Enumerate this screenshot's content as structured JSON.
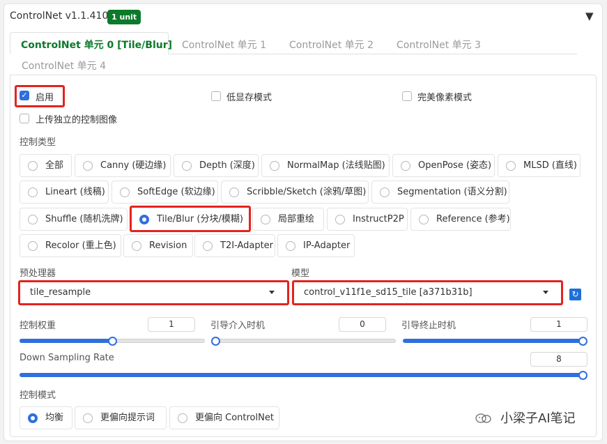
{
  "header": {
    "title": "ControlNet v1.1.410",
    "badge": "1 unit",
    "collapse_icon": "triangle-down-icon"
  },
  "tabs": [
    {
      "label": "ControlNet 单元 0 [Tile/Blur]",
      "active": true
    },
    {
      "label": "ControlNet 单元 1"
    },
    {
      "label": "ControlNet 单元 2"
    },
    {
      "label": "ControlNet 单元 3"
    },
    {
      "label": "ControlNet 单元 4"
    }
  ],
  "options": {
    "enable": {
      "label": "启用",
      "checked": true
    },
    "low_vram": {
      "label": "低显存模式",
      "checked": false
    },
    "pixel_perfect": {
      "label": "完美像素模式",
      "checked": false
    },
    "upload_independent": {
      "label": "上传独立的控制图像",
      "checked": false
    }
  },
  "control_type": {
    "label": "控制类型",
    "selected": "Tile/Blur (分块/模糊)",
    "items": [
      "全部",
      "Canny (硬边缘)",
      "Depth (深度)",
      "NormalMap (法线贴图)",
      "OpenPose (姿态)",
      "MLSD (直线)",
      "Lineart (线稿)",
      "SoftEdge (软边缘)",
      "Scribble/Sketch (涂鸦/草图)",
      "Segmentation (语义分割)",
      "Shuffle (随机洗牌)",
      "Tile/Blur (分块/模糊)",
      "局部重绘",
      "InstructP2P",
      "Reference (参考)",
      "Recolor (重上色)",
      "Revision",
      "T2I-Adapter",
      "IP-Adapter"
    ]
  },
  "preprocessor": {
    "label": "预处理器",
    "value": "tile_resample"
  },
  "model": {
    "label": "模型",
    "value": "control_v11f1e_sd15_tile [a371b31b]",
    "refresh_icon": "refresh-icon"
  },
  "sliders": {
    "weight": {
      "label": "控制权重",
      "value": "1",
      "fraction": 0.5
    },
    "start": {
      "label": "引导介入时机",
      "value": "0",
      "fraction": 0.0
    },
    "end": {
      "label": "引导终止时机",
      "value": "1",
      "fraction": 1.0
    },
    "downsample": {
      "label": "Down Sampling Rate",
      "value": "8",
      "fraction": 1.0
    }
  },
  "control_mode": {
    "label": "控制模式",
    "selected": "均衡",
    "items": [
      "均衡",
      "更偏向提示词",
      "更偏向 ControlNet"
    ]
  },
  "watermark": {
    "text": "小梁子AI笔记",
    "icon": "wechat-icon"
  },
  "colors": {
    "accent": "#2f6fde",
    "active_tab": "#0b7a2a",
    "highlight": "#e3231e"
  }
}
